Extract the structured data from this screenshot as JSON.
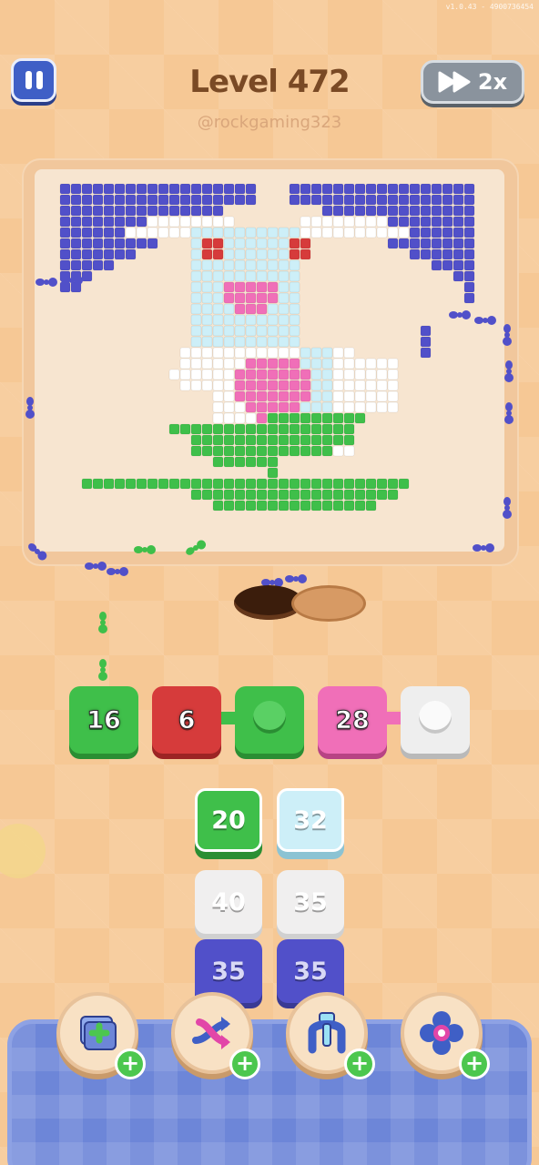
{
  "header": {
    "version": "v1.0.43 - 4900736454",
    "level": "Level 472",
    "username": "@rockgaming323",
    "speed_label": "2x"
  },
  "icons": {
    "pause": "pause-icon",
    "speed": "fast-forward-icon"
  },
  "colors": {
    "blue": "#5150c9",
    "white": "#ffffff",
    "light_blue": "#cdeff8",
    "red": "#d63b3b",
    "green": "#3fbf4a",
    "pink": "#f06fb8",
    "gray": "#e4e4e4"
  },
  "slots": [
    {
      "value": "16",
      "color": "green"
    },
    {
      "value": "6",
      "color": "red"
    },
    {
      "value": "",
      "color": "green"
    },
    {
      "value": "28",
      "color": "pink"
    },
    {
      "value": "",
      "color": "gray"
    }
  ],
  "queue": [
    {
      "value": "20",
      "color": "green"
    },
    {
      "value": "32",
      "color": "light_blue"
    },
    {
      "value": "40",
      "color": "gray"
    },
    {
      "value": "35",
      "color": "gray"
    },
    {
      "value": "35",
      "color": "blue"
    },
    {
      "value": "35",
      "color": "blue"
    }
  ],
  "boosters": [
    {
      "name": "add-slot-booster",
      "icon": "stack-plus-icon"
    },
    {
      "name": "shuffle-booster",
      "icon": "shuffle-arrows-icon"
    },
    {
      "name": "magnet-booster",
      "icon": "magnet-claw-icon"
    },
    {
      "name": "flower-booster",
      "icon": "flower-icon"
    }
  ]
}
